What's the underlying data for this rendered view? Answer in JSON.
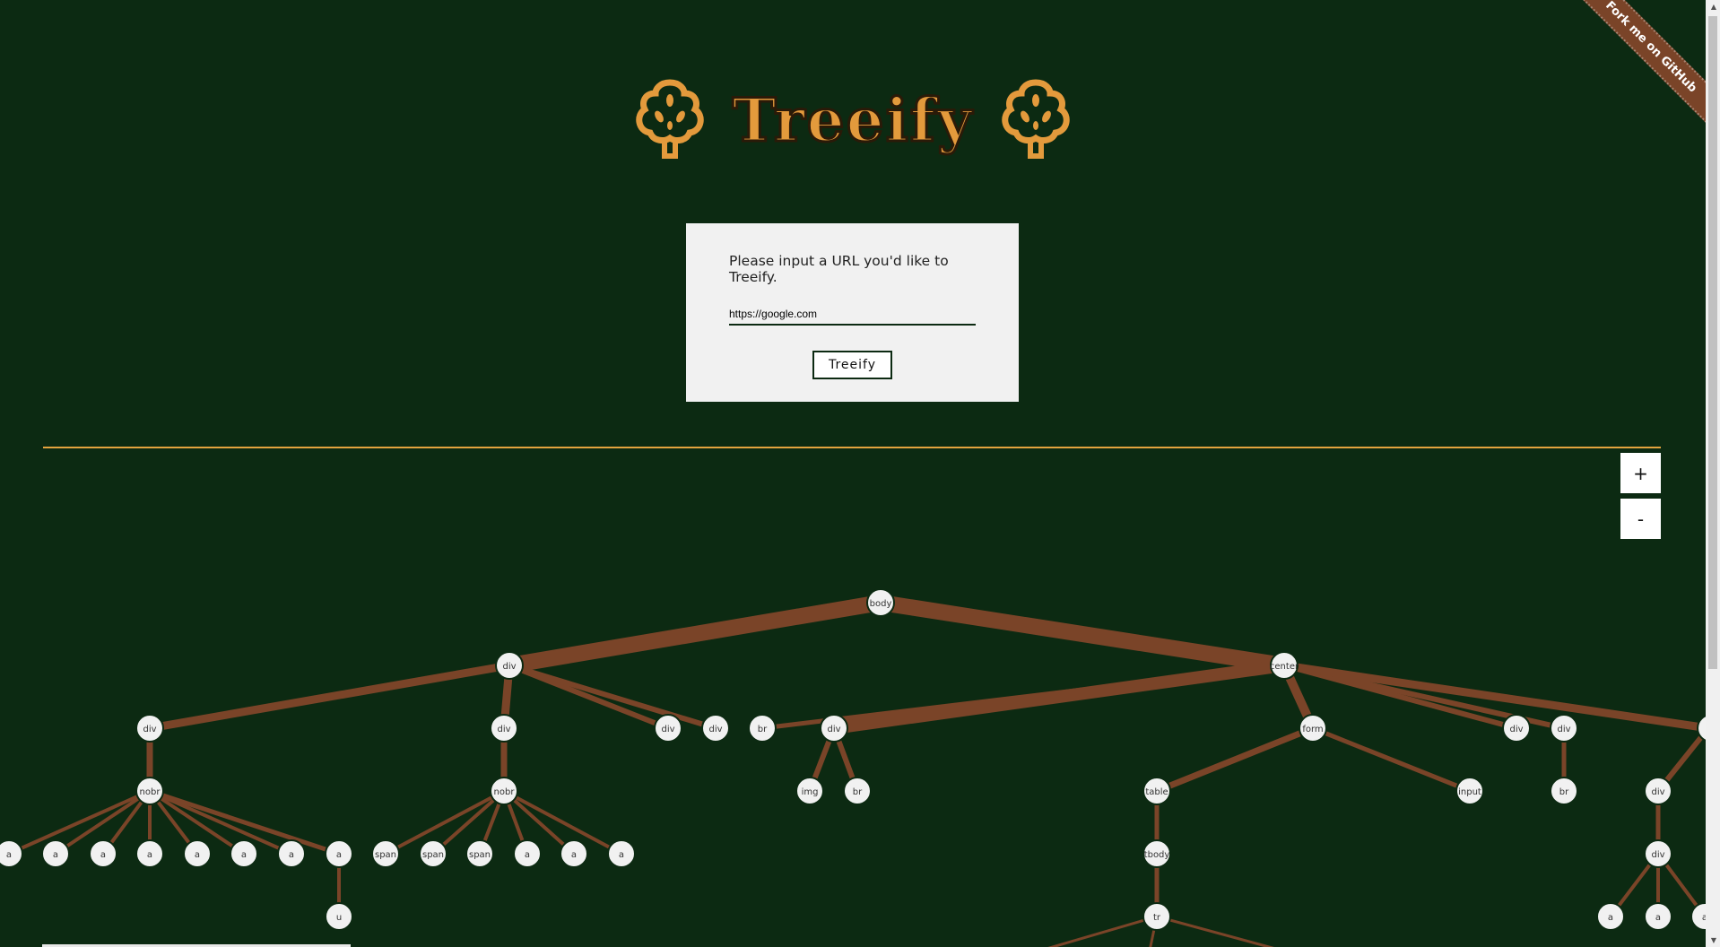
{
  "fork_banner": "Fork me on GitHub",
  "header": {
    "title": "Treeify",
    "left_icon": "tree-icon",
    "right_icon": "tree-icon"
  },
  "card": {
    "prompt": "Please input a URL you'd like to Treeify.",
    "url_value": "https://google.com",
    "button_label": "Treeify"
  },
  "zoom": {
    "in_label": "+",
    "out_label": "-"
  },
  "colors": {
    "background": "#0c2a12",
    "accent": "#e39a3c",
    "branch": "#7a4428",
    "node": "#f1f1f1"
  },
  "tree": {
    "body": "body",
    "div_a": "div",
    "center": "center",
    "div_b": "div",
    "div_c": "div",
    "div_d": "div",
    "div_e": "div",
    "br_a": "br",
    "div_f": "div",
    "form": "form",
    "div_g": "div",
    "div_h": "div",
    "nobr_a": "nobr",
    "nobr_b": "nobr",
    "img": "img",
    "br_b": "br",
    "table": "table",
    "input": "input",
    "br_c": "br",
    "div_i": "div",
    "a_1": "a",
    "a_2": "a",
    "a_3": "a",
    "a_4": "a",
    "a_5": "a",
    "a_6": "a",
    "a_7": "a",
    "a_8": "a",
    "span_1": "span",
    "span_2": "span",
    "span_3": "span",
    "a_9": "a",
    "a_10": "a",
    "a_11": "a",
    "tbody": "tbody",
    "div_j": "div",
    "u": "u",
    "tr": "tr",
    "a_12": "a",
    "a_13": "a",
    "a_14": "a"
  }
}
